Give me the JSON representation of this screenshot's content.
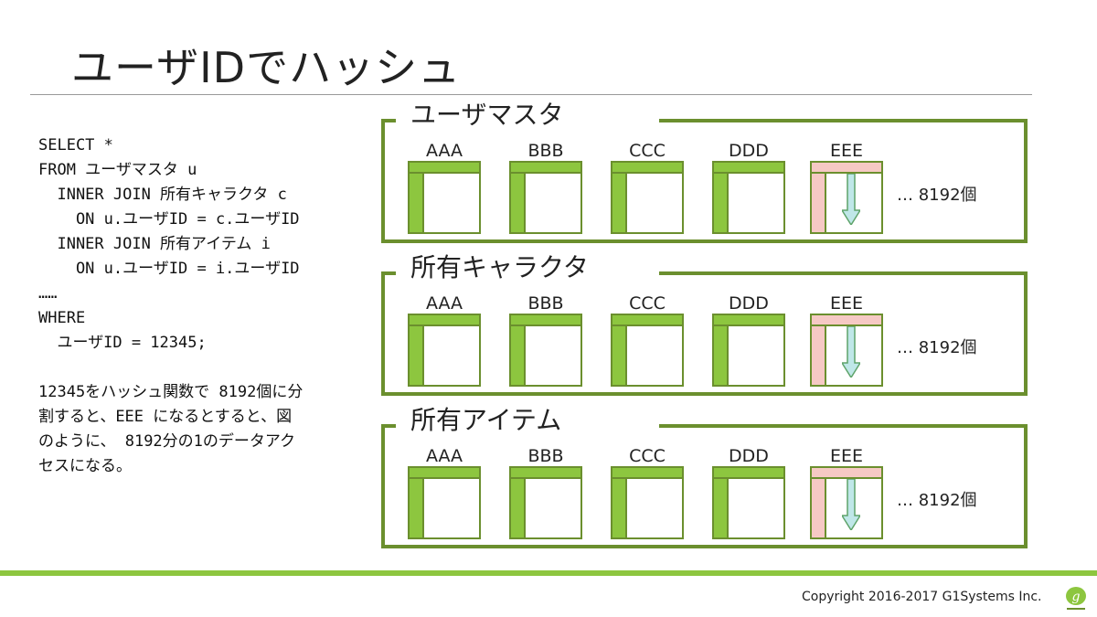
{
  "slide": {
    "title": "ユーザIDでハッシュ",
    "sql_lines": [
      "SELECT *",
      "FROM ユーザマスタ u",
      "  INNER JOIN 所有キャラクタ c",
      "    ON u.ユーザID = c.ユーザID",
      "  INNER JOIN 所有アイテム i",
      "    ON u.ユーザID = i.ユーザID",
      "……",
      "WHERE",
      "  ユーザID = 12345;"
    ],
    "note_lines": [
      "12345をハッシュ関数で 8192個に分",
      "割すると、EEE になるとすると、図",
      "のように、 8192分の1のデータアク",
      "セスになる。"
    ],
    "groups": [
      {
        "label": "ユーザマスタ",
        "partitions": [
          "AAA",
          "BBB",
          "CCC",
          "DDD",
          "EEE"
        ],
        "count": "… 8192個",
        "hit_partition": "EEE"
      },
      {
        "label": "所有キャラクタ",
        "partitions": [
          "AAA",
          "BBB",
          "CCC",
          "DDD",
          "EEE"
        ],
        "count": "… 8192個",
        "hit_partition": "EEE"
      },
      {
        "label": "所有アイテム",
        "partitions": [
          "AAA",
          "BBB",
          "CCC",
          "DDD",
          "EEE"
        ],
        "count": "… 8192個",
        "hit_partition": "EEE"
      }
    ],
    "footer": {
      "copyright": "Copyright 2016-2017 G1Systems Inc.",
      "logo_icon": "g1-logo-icon"
    },
    "colors": {
      "accent_green": "#8dc63f",
      "frame_green": "#6b8f2e",
      "hit_pink": "#f6c9c4",
      "arrow_cyan": "#bfe7e8"
    }
  }
}
